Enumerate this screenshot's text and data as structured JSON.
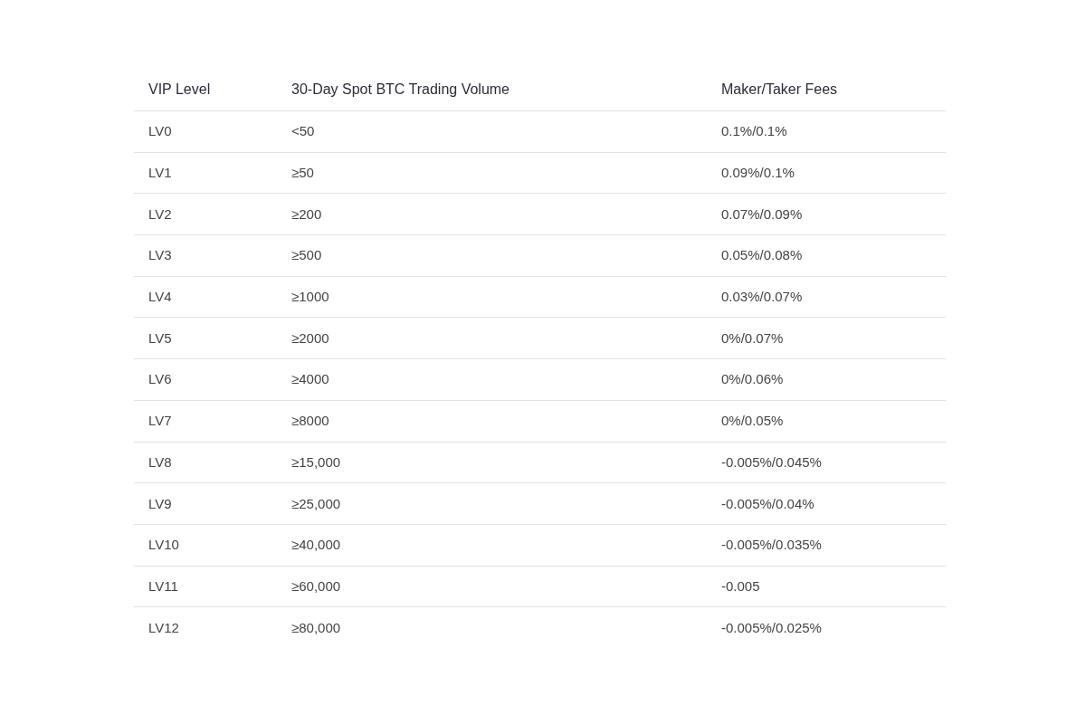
{
  "table": {
    "columns": [
      "VIP Level",
      "30-Day Spot BTC Trading Volume",
      "Maker/Taker Fees"
    ],
    "rows": [
      [
        "LV0",
        "<50",
        "0.1%/0.1%"
      ],
      [
        "LV1",
        "≥50",
        "0.09%/0.1%"
      ],
      [
        "LV2",
        "≥200",
        "0.07%/0.09%"
      ],
      [
        "LV3",
        "≥500",
        "0.05%/0.08%"
      ],
      [
        "LV4",
        "≥1000",
        "0.03%/0.07%"
      ],
      [
        "LV5",
        "≥2000",
        "0%/0.07%"
      ],
      [
        "LV6",
        "≥4000",
        "0%/0.06%"
      ],
      [
        "LV7",
        "≥8000",
        "0%/0.05%"
      ],
      [
        "LV8",
        "≥15,000",
        "-0.005%/0.045%"
      ],
      [
        "LV9",
        "≥25,000",
        "-0.005%/0.04%"
      ],
      [
        "LV10",
        "≥40,000",
        "-0.005%/0.035%"
      ],
      [
        "LV11",
        "≥60,000",
        "-0.005"
      ],
      [
        "LV12",
        "≥80,000",
        "-0.005%/0.025%"
      ]
    ]
  }
}
